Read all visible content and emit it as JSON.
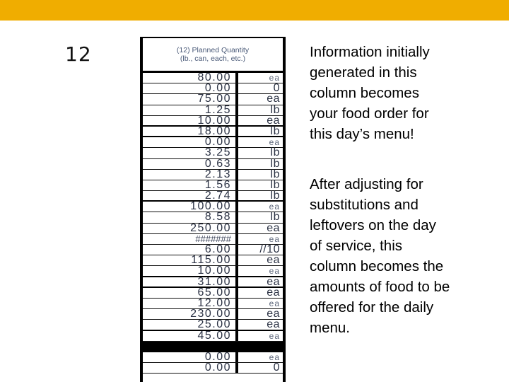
{
  "slide": {
    "number": "12",
    "accent_color": "#f0ad00"
  },
  "table": {
    "header_line1": "(12) Planned Quantity",
    "header_line2": "(lb., can, each, etc.)",
    "rows": [
      {
        "value": "80.00",
        "unit": "ea"
      },
      {
        "value": "0.00",
        "unit": "0"
      },
      {
        "value": "75.00",
        "unit": "ea"
      },
      {
        "value": "1.25",
        "unit": "lb"
      },
      {
        "value": "10.00",
        "unit": "ea"
      },
      {
        "value": "18.00",
        "unit": "lb"
      },
      {
        "value": "0.00",
        "unit": "ea"
      },
      {
        "value": "3.25",
        "unit": "lb"
      },
      {
        "value": "0.63",
        "unit": "lb"
      },
      {
        "value": "2.13",
        "unit": "lb"
      },
      {
        "value": "1.56",
        "unit": "lb"
      },
      {
        "value": "2.74",
        "unit": "lb"
      },
      {
        "value": "100.00",
        "unit": "ea"
      },
      {
        "value": "8.58",
        "unit": "lb"
      },
      {
        "value": "250.00",
        "unit": "ea"
      },
      {
        "value": "#######",
        "unit": "ea"
      },
      {
        "value": "6.00",
        "unit": "//10"
      },
      {
        "value": "115.00",
        "unit": "ea"
      },
      {
        "value": "10.00",
        "unit": "ea"
      },
      {
        "value": "31.00",
        "unit": "ea"
      },
      {
        "value": "65.00",
        "unit": "ea"
      },
      {
        "value": "12.00",
        "unit": "ea"
      },
      {
        "value": "230.00",
        "unit": "ea"
      },
      {
        "value": "25.00",
        "unit": "ea"
      },
      {
        "value": "45.00",
        "unit": "ea"
      }
    ],
    "rows_after_bar": [
      {
        "value": "0.00",
        "unit": "ea"
      },
      {
        "value": "0.00",
        "unit": "0"
      }
    ]
  },
  "description": {
    "paragraph1": "Information initially generated in this column becomes your food order for this day’s menu!",
    "paragraph2": "After adjusting for substitutions and leftovers on the day of service, this column becomes the amounts of food to be offered for the daily menu."
  }
}
